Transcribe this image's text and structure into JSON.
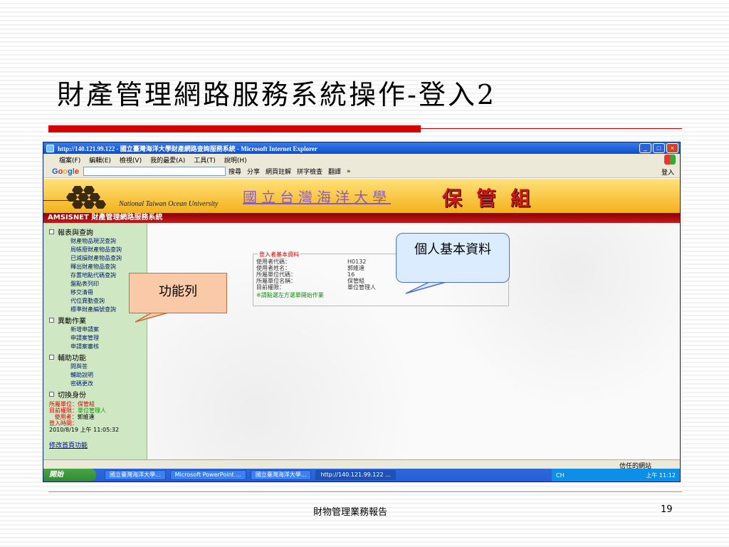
{
  "slide": {
    "title": "財產管理網路服務系統操作-登入2",
    "footer": "財物管理業務報告",
    "page_number": "19"
  },
  "browser": {
    "title": "http://140.121.99.122 - 國立臺灣海洋大學財產網路查詢服務系統 - Microsoft Internet Explorer",
    "menu": [
      "檔案(F)",
      "編輯(E)",
      "檢視(V)",
      "我的最愛(A)",
      "工具(T)",
      "說明(H)"
    ],
    "toolbar": {
      "google": [
        "G",
        "o",
        "o",
        "g",
        "l",
        "e"
      ],
      "items": [
        "搜尋",
        "分享",
        "網頁註解",
        "拼字檢查",
        "翻譯",
        "»"
      ],
      "login": "登入"
    },
    "status": "信任的網站"
  },
  "app": {
    "univ_en": "National Taiwan Ocean University",
    "univ_zh": "國立台灣海洋大學",
    "dept": "保管組",
    "subheader": "AMSISNET 財產管理網路服務系統",
    "nav": [
      {
        "group": "報表與查詢",
        "items": [
          "財產物品現況查詢",
          "局帳廢財產物品查詢",
          "已減損財產物品查詢",
          "釋出財產物品查詢",
          "存置地點代碼查詢",
          "盤點表列印",
          "移交清冊",
          "代位異動查詢",
          "標準財產編號查詢"
        ]
      },
      {
        "group": "異動作業",
        "items": [
          "新增申請案",
          "申請案管理",
          "申請案審核"
        ]
      },
      {
        "group": "輔助功能",
        "items": [
          "問與答",
          "輔助說明",
          "密碼更改"
        ]
      },
      {
        "group": "切換身份",
        "items": []
      }
    ],
    "session": {
      "unit_label": "所屬單位：",
      "unit_value": "保管組",
      "perm_label": "目前權限：",
      "perm_value": "單位管理人",
      "user_label": "使用者：",
      "user_value": "郭維達",
      "time_label": "登入時間：",
      "time_value": "2010/8/19 上午 11:05:32"
    },
    "home_link": "修改首頁功能",
    "user_info": {
      "legend": "登入者基本資料",
      "rows": [
        {
          "label": "使用者代碼：",
          "value": "H0132"
        },
        {
          "label": "使用者姓名：",
          "value": "郭維達"
        },
        {
          "label": "所屬單位代碼：",
          "value": "16"
        },
        {
          "label": "所屬單位名稱：",
          "value": "保管組"
        },
        {
          "label": "目前權限：",
          "value": "單位管理人"
        }
      ],
      "note": "※請點選左方選單開始作業"
    }
  },
  "taskbar": {
    "start": "開始",
    "tasks": [
      "國立臺灣海洋大學...",
      "Microsoft PowerPoint ...",
      "國立臺灣海洋大學...",
      "http://140.121.99.122 ..."
    ],
    "lang": "CH",
    "clock": "上午 11:12"
  },
  "callouts": {
    "personal_info": "個人基本資料",
    "function_bar": "功能列"
  },
  "colors": {
    "title_rule": "#d40000",
    "header_bg": "#f3b21b",
    "subheader_bg": "#c41a1a",
    "nav_bg": "#cfe8c3",
    "callout_blue": "#dcecff",
    "callout_orange": "#f9c9a8"
  }
}
